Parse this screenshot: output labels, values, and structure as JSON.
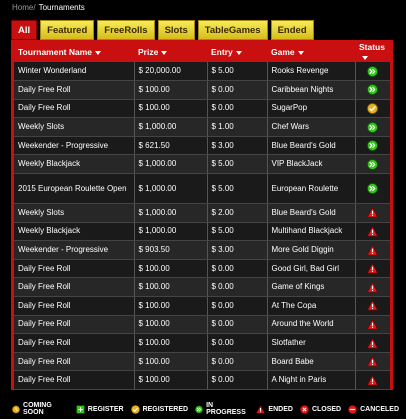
{
  "breadcrumb": {
    "home": "Home/",
    "current": "Tournaments"
  },
  "tabs": [
    {
      "label": "All",
      "active": true
    },
    {
      "label": "Featured",
      "active": false
    },
    {
      "label": "FreeRolls",
      "active": false
    },
    {
      "label": "Slots",
      "active": false
    },
    {
      "label": "TableGames",
      "active": false
    },
    {
      "label": "Ended",
      "active": false
    }
  ],
  "columns": [
    "Tournament Name",
    "Prize",
    "Entry",
    "Game",
    "Status"
  ],
  "rows": [
    {
      "name": "Winter Wonderland",
      "prize": "$ 20,000.00",
      "entry": "$ 5.00",
      "game": "Rooks Revenge",
      "status": "in-progress"
    },
    {
      "name": "Daily Free Roll",
      "prize": "$ 100.00",
      "entry": "$ 0.00",
      "game": "Caribbean Nights",
      "status": "in-progress"
    },
    {
      "name": "Daily Free Roll",
      "prize": "$ 100.00",
      "entry": "$ 0.00",
      "game": "SugarPop",
      "status": "registered"
    },
    {
      "name": "Weekly Slots",
      "prize": "$ 1,000.00",
      "entry": "$ 1.00",
      "game": "Chef Wars",
      "status": "in-progress"
    },
    {
      "name": "Weekender - Progressive",
      "prize": "$ 621.50",
      "entry": "$ 3.00",
      "game": "Blue Beard's Gold",
      "status": "in-progress"
    },
    {
      "name": "Weekly Blackjack",
      "prize": "$ 1,000.00",
      "entry": "$ 5.00",
      "game": "VIP BlackJack",
      "status": "in-progress"
    },
    {
      "name": "2015 European Roulette Open",
      "prize": "$ 1,000.00",
      "entry": "$ 5.00",
      "game": "European Roulette",
      "status": "in-progress"
    },
    {
      "name": "Weekly Slots",
      "prize": "$ 1,000.00",
      "entry": "$ 2.00",
      "game": "Blue Beard's Gold",
      "status": "ended"
    },
    {
      "name": "Weekly Blackjack",
      "prize": "$ 1,000.00",
      "entry": "$ 5.00",
      "game": "Multihand Blackjack",
      "status": "ended"
    },
    {
      "name": "Weekender - Progressive",
      "prize": "$ 903.50",
      "entry": "$ 3.00",
      "game": "More Gold Diggin",
      "status": "ended"
    },
    {
      "name": "Daily Free Roll",
      "prize": "$ 100.00",
      "entry": "$ 0.00",
      "game": "Good Girl, Bad Girl",
      "status": "ended"
    },
    {
      "name": "Daily Free Roll",
      "prize": "$ 100.00",
      "entry": "$ 0.00",
      "game": "Game of Kings",
      "status": "ended"
    },
    {
      "name": "Daily Free Roll",
      "prize": "$ 100.00",
      "entry": "$ 0.00",
      "game": "At The Copa",
      "status": "ended"
    },
    {
      "name": "Daily Free Roll",
      "prize": "$ 100.00",
      "entry": "$ 0.00",
      "game": "Around the World",
      "status": "ended"
    },
    {
      "name": "Daily Free Roll",
      "prize": "$ 100.00",
      "entry": "$ 0.00",
      "game": "Slotfather",
      "status": "ended"
    },
    {
      "name": "Daily Free Roll",
      "prize": "$ 100.00",
      "entry": "$ 0.00",
      "game": "Board Babe",
      "status": "ended"
    },
    {
      "name": "Daily Free Roll",
      "prize": "$ 100.00",
      "entry": "$ 0.00",
      "game": "A Night in Paris",
      "status": "ended"
    }
  ],
  "legend": [
    {
      "icon": "coming-soon-icon",
      "label": "COMING SOON"
    },
    {
      "icon": "register-icon",
      "label": "REGISTER"
    },
    {
      "icon": "registered-icon",
      "label": "REGISTERED"
    },
    {
      "icon": "in-progress-icon",
      "label": "IN PROGRESS"
    },
    {
      "icon": "ended-icon",
      "label": "ENDED"
    },
    {
      "icon": "closed-icon",
      "label": "CLOSED"
    },
    {
      "icon": "canceled-icon",
      "label": "CANCELED"
    }
  ],
  "colors": {
    "accent": "#c90f0f",
    "tab_yellow": "#f0dc3a",
    "in_progress": "#35c31b",
    "registered": "#e8b21a",
    "ended": "#e21818"
  }
}
